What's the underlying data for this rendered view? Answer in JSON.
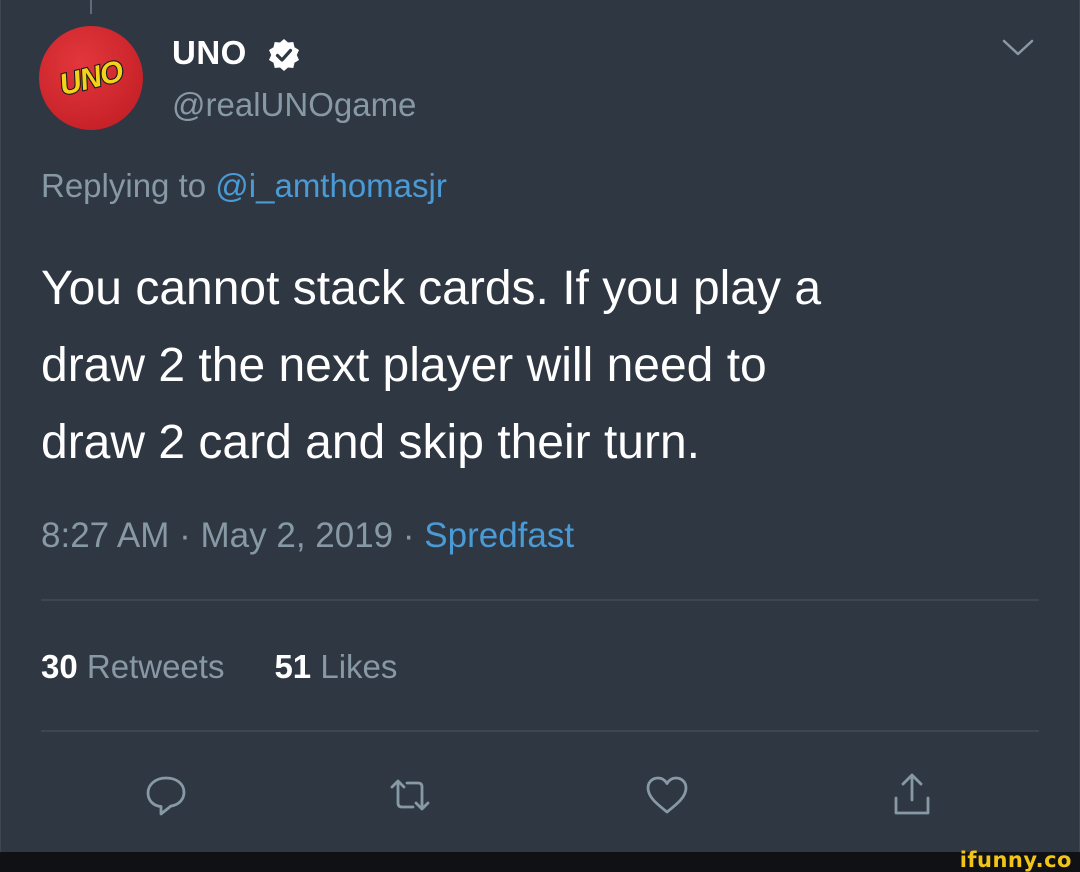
{
  "account": {
    "name": "UNO",
    "handle": "@realUNOgame",
    "avatar_text": "UNO",
    "verified": true
  },
  "reply": {
    "prefix": "Replying to",
    "mention": "@i_amthomasjr"
  },
  "tweet": {
    "lines": [
      "You cannot stack cards. If you play a",
      "draw 2 the next player will need to",
      "draw 2 card and skip their turn."
    ]
  },
  "meta": {
    "time": "8:27 AM",
    "separator": " · ",
    "date": "May 2, 2019",
    "source": "Spredfast"
  },
  "stats": {
    "retweets_count": "30",
    "retweets_label": "Retweets",
    "likes_count": "51",
    "likes_label": "Likes"
  },
  "actions": [
    "reply-icon",
    "retweet-icon",
    "like-icon",
    "share-icon"
  ],
  "watermark": "ifunny.co",
  "colors": {
    "background": "#2f3742",
    "text": "#ffffff",
    "muted": "#8899a6",
    "link": "#4a9ad6",
    "divider": "#3d4753",
    "verified_badge": "#ffffff",
    "avatar_red": "#c9232a",
    "avatar_yellow": "#f3d21c",
    "watermark": "#f2c417"
  }
}
